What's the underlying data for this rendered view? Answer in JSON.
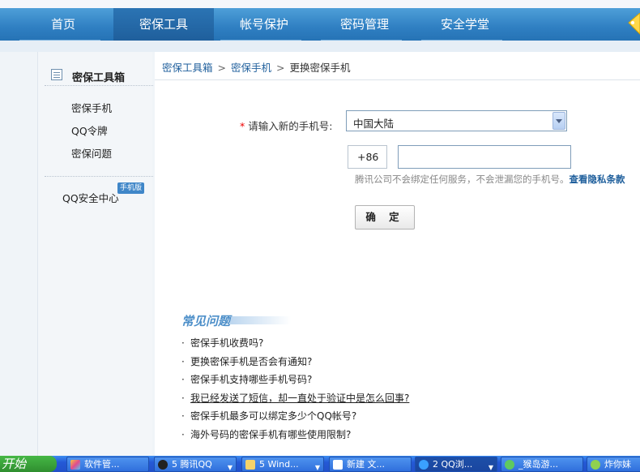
{
  "nav": {
    "items": [
      {
        "label": "首页"
      },
      {
        "label": "密保工具"
      },
      {
        "label": "帐号保护"
      },
      {
        "label": "密码管理"
      },
      {
        "label": "安全学堂"
      }
    ]
  },
  "sidebar": {
    "title": "密保工具箱",
    "items": [
      {
        "label": "密保手机"
      },
      {
        "label": "QQ令牌"
      },
      {
        "label": "密保问题"
      }
    ],
    "safety_center": "QQ安全中心",
    "safety_badge": "手机版"
  },
  "breadcrumb": {
    "items": [
      "密保工具箱",
      "密保手机"
    ],
    "current": "更换密保手机",
    "separator": ">"
  },
  "form": {
    "required_mark": "*",
    "phone_label": "请输入新的手机号:",
    "region_value": "中国大陆",
    "country_code": "+86",
    "phone_value": "",
    "hint_text": "腾讯公司不会绑定任何服务，不会泄漏您的手机号。",
    "privacy_link": "查看隐私条款",
    "confirm_button": "确 定"
  },
  "faq": {
    "title": "常见问题",
    "bullet": "·",
    "items": [
      "密保手机收费吗?",
      "更换密保手机是否会有通知?",
      "密保手机支持哪些手机号码?",
      "我已经发送了短信，却一直处于验证中是怎么回事?",
      "密保手机最多可以绑定多少个QQ帐号?",
      "海外号码的密保手机有哪些使用限制?"
    ]
  },
  "taskbar": {
    "start_label": "开始",
    "buttons": [
      {
        "label": "软件管...",
        "icon": "app-icon"
      },
      {
        "label": "5 腾讯QQ",
        "icon": "qq-icon"
      },
      {
        "label": "5 Wind...",
        "icon": "folder-icon"
      },
      {
        "label": "新建 文...",
        "icon": "document-icon"
      },
      {
        "label": "2 QQ浏...",
        "icon": "browser-icon"
      },
      {
        "label": "_猴岛游...",
        "icon": "ie-icon"
      },
      {
        "label": "炸你妹",
        "icon": "game-icon"
      }
    ]
  },
  "colors": {
    "nav_bg": "#2f7fc2",
    "link": "#1f5f9c",
    "required": "#ee0000",
    "taskbar": "#2459d6"
  }
}
